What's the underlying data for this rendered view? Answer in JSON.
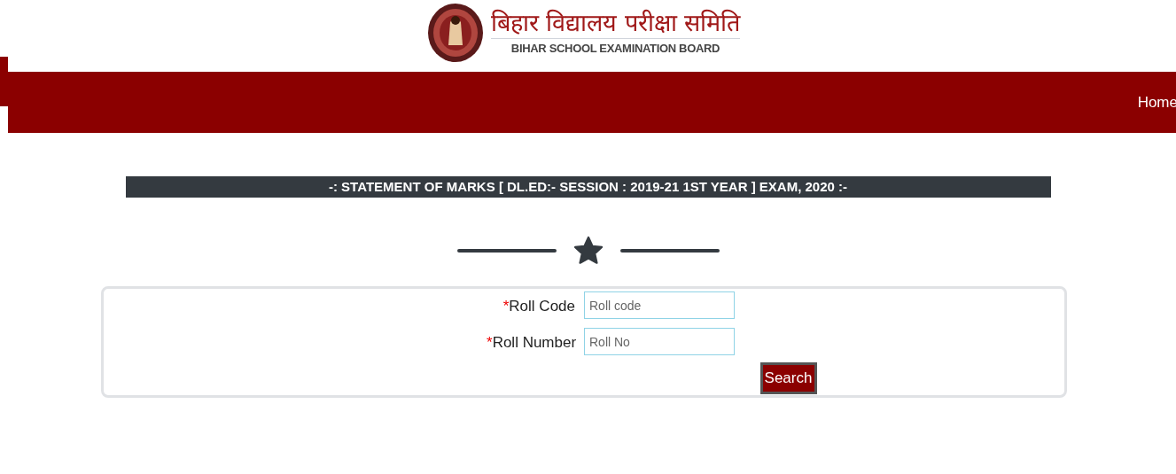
{
  "header": {
    "title_hindi": "बिहार विद्यालय परीक्षा समिति",
    "title_english": "BIHAR SCHOOL EXAMINATION BOARD"
  },
  "nav": {
    "items": [
      "Home"
    ]
  },
  "banner": "-: STATEMENT OF MARKS [ DL.ED:- SESSION : 2019-21 1ST YEAR ] EXAM, 2020 :-",
  "form": {
    "fields": [
      {
        "required_mark": "*",
        "label": "Roll Code",
        "placeholder": "Roll code"
      },
      {
        "required_mark": "*",
        "label": "Roll Number",
        "placeholder": "Roll No"
      }
    ],
    "button": "Search"
  }
}
